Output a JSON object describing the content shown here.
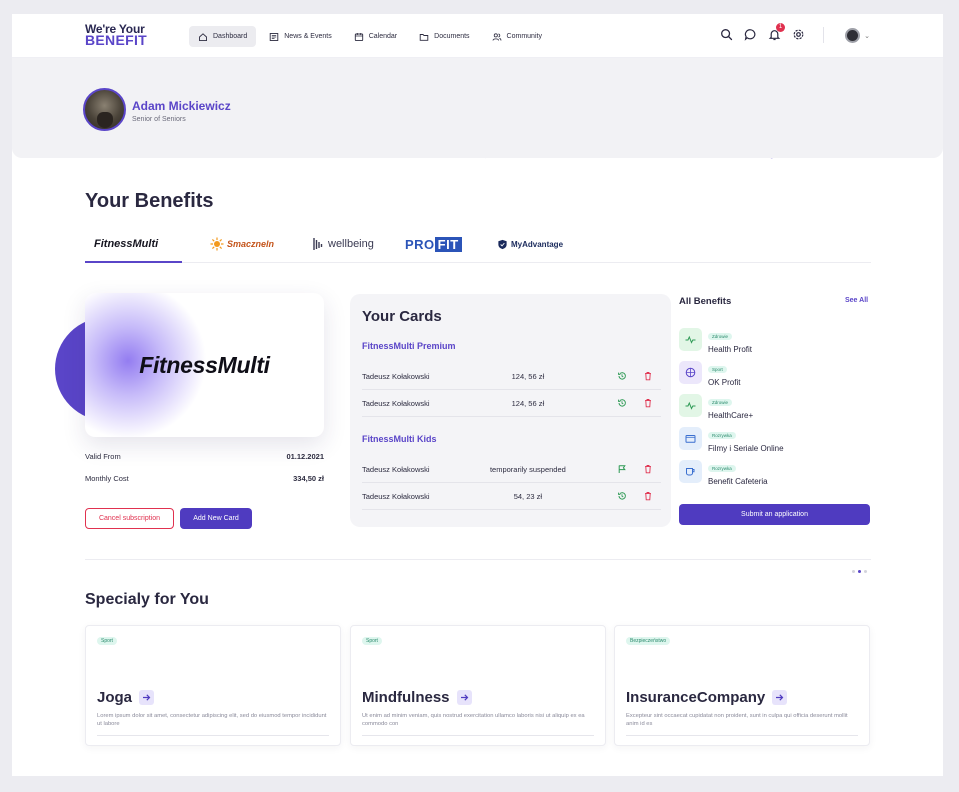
{
  "logo": {
    "line1": "We're Your",
    "line2": "BENEFIT"
  },
  "nav": [
    {
      "label": "Dashboard",
      "icon": "home-icon",
      "active": true
    },
    {
      "label": "News & Events",
      "icon": "newspaper-icon"
    },
    {
      "label": "Calendar",
      "icon": "calendar-icon"
    },
    {
      "label": "Documents",
      "icon": "folder-icon"
    },
    {
      "label": "Community",
      "icon": "people-icon"
    }
  ],
  "header": {
    "notification_count": "1"
  },
  "profile": {
    "name": "Adam Mickiewicz",
    "role": "Senior of Seniors"
  },
  "benefits": {
    "title": "Your Benefits",
    "brands": [
      "FitnessMulti",
      "Smaczneln",
      "wellbeing",
      "PRO",
      "FIT",
      "MyAdvantage"
    ],
    "active_brand": "FitnessMulti"
  },
  "card": {
    "brand_text": "FitnessMulti",
    "valid_from_label": "Valid From",
    "valid_from": "01.12.2021",
    "monthly_cost_label": "Monthly Cost",
    "monthly_cost": "334,50 zł",
    "cancel_label": "Cancel subscription",
    "add_label": "Add New Card"
  },
  "your_cards": {
    "title": "Your Cards",
    "groups": [
      {
        "name": "FitnessMulti Premium",
        "rows": [
          {
            "holder": "Tadeusz Kołakowski",
            "amount": "124, 56 zł",
            "action": "history-icon"
          },
          {
            "holder": "Tadeusz Kołakowski",
            "amount": "124, 56 zł",
            "action": "history-icon"
          }
        ]
      },
      {
        "name": "FitnessMulti Kids",
        "rows": [
          {
            "holder": "Tadeusz Kołakowski",
            "amount": "temporarily suspended",
            "action": "flag-icon"
          },
          {
            "holder": "Tadeusz Kołakowski",
            "amount": "54, 23 zł",
            "action": "history-icon"
          }
        ]
      }
    ]
  },
  "all_benefits": {
    "title": "All Benefits",
    "see_all": "See All",
    "items": [
      {
        "tag": "Zdrowie",
        "name": "Health Profit",
        "icon": "pulse-icon",
        "color": "#e2f6e6"
      },
      {
        "tag": "Sport",
        "name": "OK Profit",
        "icon": "ball-icon",
        "color": "#ece7fb"
      },
      {
        "tag": "Zdrowie",
        "name": "HealthCare+",
        "icon": "pulse-icon",
        "color": "#e2f6e6"
      },
      {
        "tag": "Rozrywka",
        "name": "Filmy i Seriale Online",
        "icon": "tv-icon",
        "color": "#e4eefb"
      },
      {
        "tag": "Rozrywka",
        "name": "Benefit Cafeteria",
        "icon": "cup-icon",
        "color": "#e4eefb"
      }
    ],
    "submit_label": "Submit an application"
  },
  "special": {
    "title": "Specialy for You",
    "cards": [
      {
        "tag": "Sport",
        "title": "Joga",
        "desc": "Lorem ipsum dolor sit amet, consectetur adipiscing elit, sed do eiusmod tempor incididunt ut labore"
      },
      {
        "tag": "Sport",
        "title": "Mindfulness",
        "desc": "Ut enim ad minim veniam, quis nostrud exercitation ullamco laboris nisi ut aliquip ex ea commodo con"
      },
      {
        "tag": "Bezpieczeństwo",
        "title": "InsuranceCompany",
        "desc": "Excepteur sint occaecat cupidatat non proident, sunt in culpa qui officia deserunt mollit anim id es"
      }
    ]
  },
  "colors": {
    "accent": "#5a45c8",
    "danger": "#e0314f",
    "success": "#2e9a55"
  }
}
